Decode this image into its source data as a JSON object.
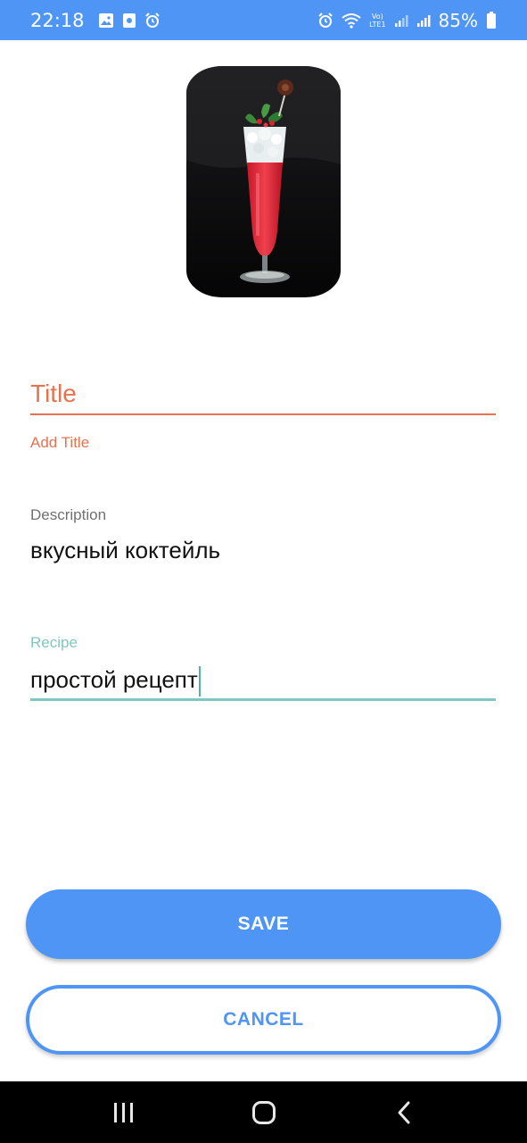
{
  "status_bar": {
    "time": "22:18",
    "network": "Vo)\nLTE1",
    "battery_percent": "85%",
    "color": "#4f95f5"
  },
  "form": {
    "title": {
      "placeholder": "Title",
      "value": "",
      "error": "Add Title",
      "color": "#e6734f"
    },
    "description": {
      "label": "Description",
      "value": "вкусный коктейль"
    },
    "recipe": {
      "label": "Recipe",
      "value": "простой рецепт",
      "color": "#7fc7c0"
    }
  },
  "buttons": {
    "save_label": "SAVE",
    "cancel_label": "CANCEL",
    "accent": "#4f95f5"
  },
  "image": {
    "icon": "cocktail-photo"
  },
  "nav": {
    "icons": [
      "recent-apps-icon",
      "home-icon",
      "back-icon"
    ]
  }
}
